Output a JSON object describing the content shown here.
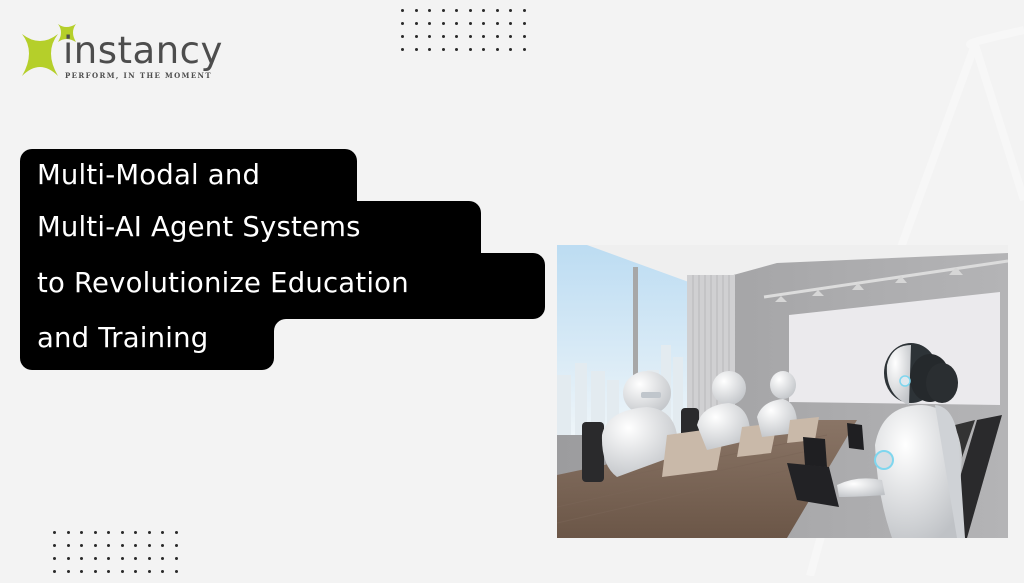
{
  "brand": {
    "name": "instancy",
    "tagline": "PERFORM, IN THE MOMENT",
    "accent_color": "#b5cf2a",
    "text_color": "#4d4d4d"
  },
  "headline": {
    "lines": [
      "Multi-Modal and",
      "Multi-AI Agent Systems",
      "to Revolutionize Education",
      "and Training"
    ],
    "background_color": "#000000",
    "text_color": "#ffffff"
  },
  "image": {
    "alt": "Humanoid robots working on laptops around a conference table"
  },
  "decorations": {
    "dot_grid_top": {
      "columns": 10,
      "rows": 4
    },
    "dot_grid_bottom": {
      "columns": 10,
      "rows": 4
    }
  }
}
